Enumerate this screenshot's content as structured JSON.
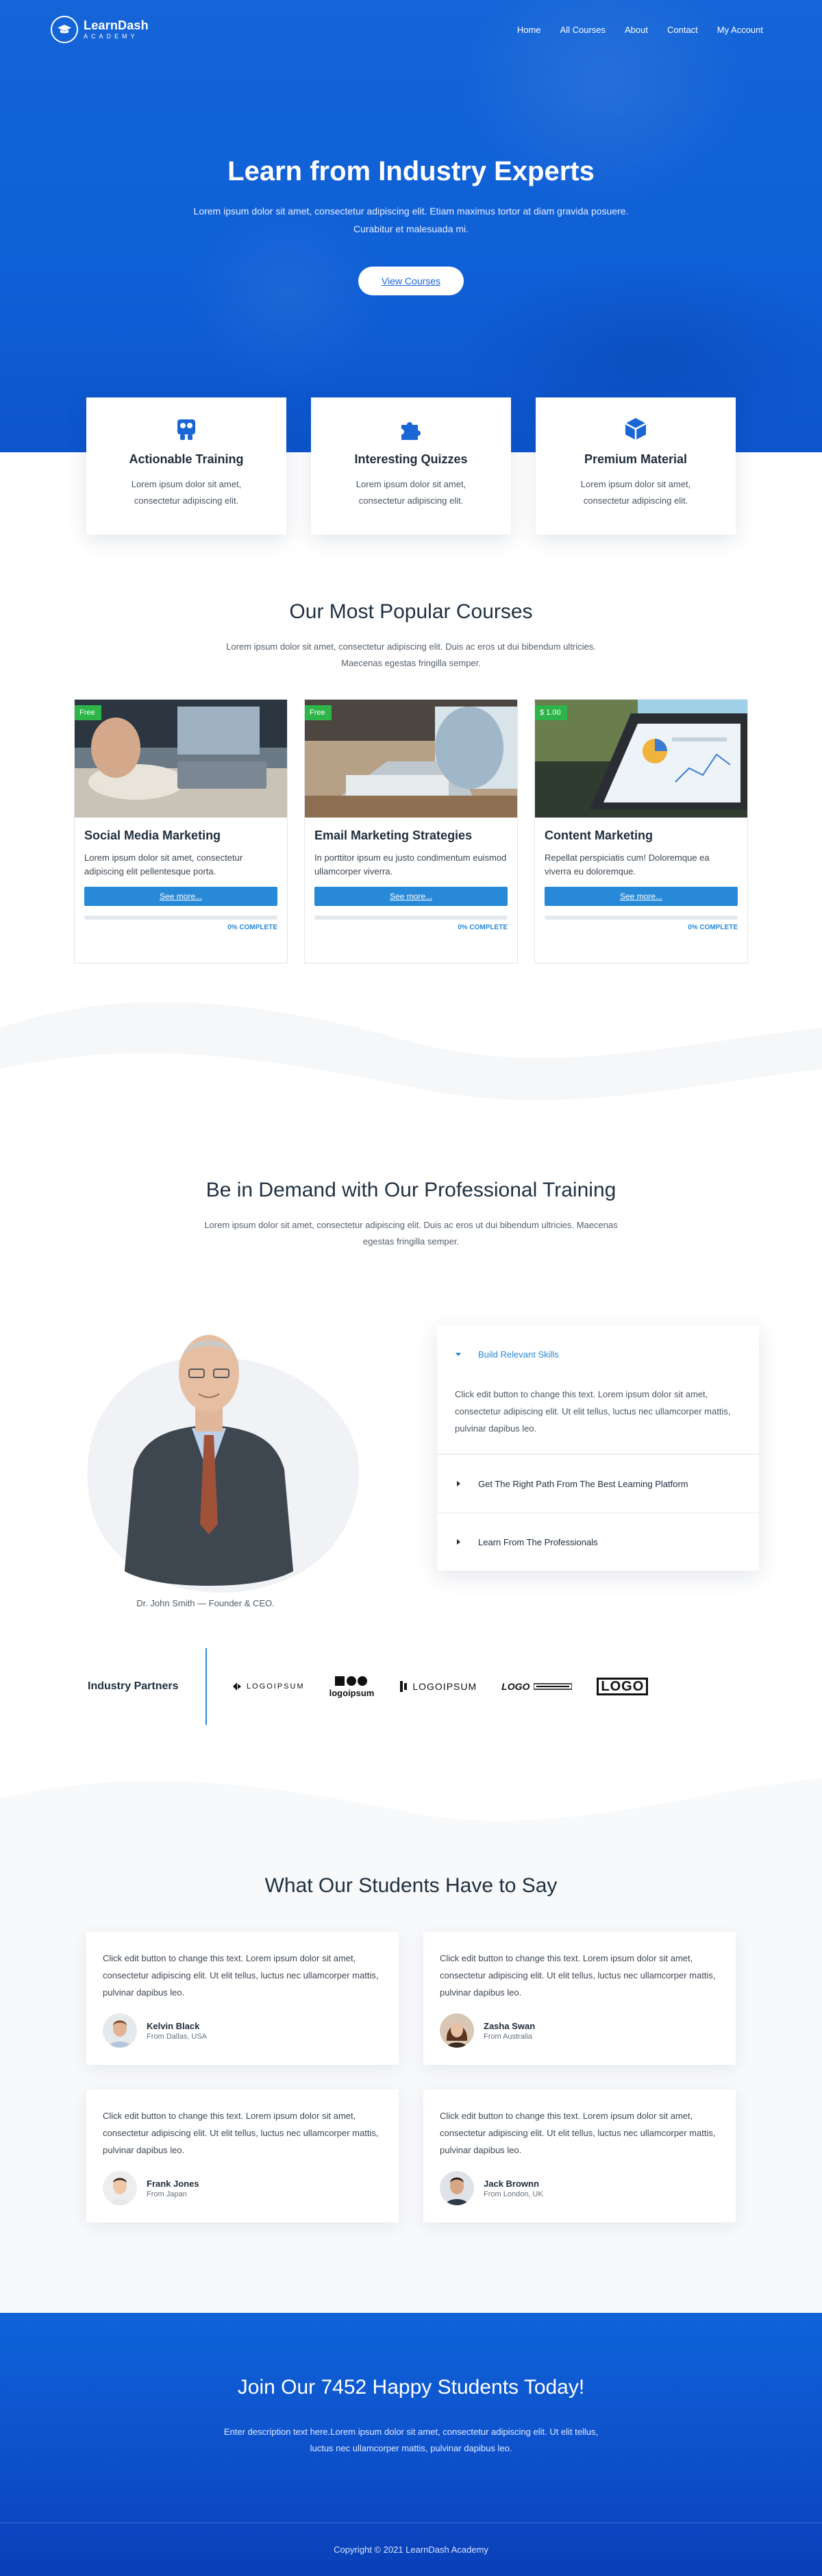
{
  "brand": {
    "name": "LearnDash",
    "sub": "ACADEMY"
  },
  "nav": {
    "items": [
      "Home",
      "All Courses",
      "About",
      "Contact",
      "My Account"
    ]
  },
  "hero": {
    "title": "Learn from Industry Experts",
    "description": "Lorem ipsum dolor sit amet, consectetur adipiscing elit. Etiam maximus tortor at diam gravida posuere. Curabitur et malesuada mi.",
    "button": "View Courses"
  },
  "features": [
    {
      "icon": "training-icon",
      "title": "Actionable Training",
      "desc": "Lorem ipsum dolor sit amet, consectetur adipiscing elit."
    },
    {
      "icon": "puzzle-icon",
      "title": "Interesting Quizzes",
      "desc": "Lorem ipsum dolor sit amet, consectetur adipiscing elit."
    },
    {
      "icon": "box-icon",
      "title": "Premium Material",
      "desc": "Lorem ipsum dolor sit amet, consectetur adipiscing elit."
    }
  ],
  "popular": {
    "title": "Our Most Popular Courses",
    "description": "Lorem ipsum dolor sit amet, consectetur adipiscing elit. Duis ac eros ut dui bibendum ultricies. Maecenas egestas fringilla semper.",
    "courses": [
      {
        "badge": "Free",
        "title": "Social Media Marketing",
        "desc": "Lorem ipsum dolor sit amet, consectetur adipiscing elit pellentesque porta.",
        "button": "See more...",
        "progress": "0% COMPLETE",
        "progress_value": 0
      },
      {
        "badge": "Free",
        "title": "Email Marketing Strategies",
        "desc": "In porttitor ipsum eu justo condimentum euismod ullamcorper viverra.",
        "button": "See more...",
        "progress": "0% COMPLETE",
        "progress_value": 0
      },
      {
        "badge": "$ 1.00",
        "title": "Content Marketing",
        "desc": "Repellat perspiciatis cum! Doloremque ea viverra eu doloremque.",
        "button": "See more...",
        "progress": "0% COMPLETE",
        "progress_value": 0
      }
    ]
  },
  "training": {
    "title": "Be in Demand with Our Professional Training",
    "description": "Lorem ipsum dolor sit amet, consectetur adipiscing elit. Duis ac eros ut dui bibendum ultricies. Maecenas egestas fringilla semper.",
    "caption": "Dr. John Smith — Founder & CEO.",
    "accordion": [
      {
        "title": "Build Relevant Skills",
        "open": true,
        "body": "Click edit button to change this text. Lorem ipsum dolor sit amet, consectetur adipiscing elit. Ut elit tellus, luctus nec ullamcorper mattis, pulvinar dapibus leo."
      },
      {
        "title": "Get The Right Path From The Best Learning Platform",
        "open": false
      },
      {
        "title": "Learn From The Professionals",
        "open": false
      }
    ]
  },
  "partners": {
    "label": "Industry Partners",
    "logos": [
      "LOGOIPSUM",
      "logoipsum",
      "LOGOIPSUM",
      "LOGO",
      "LOGO"
    ]
  },
  "testimonials": {
    "title": "What Our Students Have to Say",
    "items": [
      {
        "text": "Click edit button to change this text. Lorem ipsum dolor sit amet, consectetur adipiscing elit. Ut elit tellus, luctus nec ullamcorper mattis, pulvinar dapibus leo.",
        "name": "Kelvin Black",
        "from": "From Dallas, USA"
      },
      {
        "text": "Click edit button to change this text. Lorem ipsum dolor sit amet, consectetur adipiscing elit. Ut elit tellus, luctus nec ullamcorper mattis, pulvinar dapibus leo.",
        "name": "Zasha Swan",
        "from": "From Australia"
      },
      {
        "text": "Click edit button to change this text. Lorem ipsum dolor sit amet, consectetur adipiscing elit. Ut elit tellus, luctus nec ullamcorper mattis, pulvinar dapibus leo.",
        "name": "Frank Jones",
        "from": "From Japan"
      },
      {
        "text": "Click edit button to change this text. Lorem ipsum dolor sit amet, consectetur adipiscing elit. Ut elit tellus, luctus nec ullamcorper mattis, pulvinar dapibus leo.",
        "name": "Jack Brownn",
        "from": "From London, UK"
      }
    ]
  },
  "cta": {
    "title": "Join Our 7452 Happy Students Today!",
    "description": "Enter description text here.Lorem ipsum dolor sit amet, consectetur adipiscing elit. Ut elit tellus, luctus nec ullamcorper mattis, pulvinar dapibus leo."
  },
  "footer": {
    "copyright": "Copyright © 2021 LearnDash Academy"
  },
  "colors": {
    "primary": "#1565d8",
    "accent": "#2889d8",
    "badge_green": "#2db54a"
  }
}
